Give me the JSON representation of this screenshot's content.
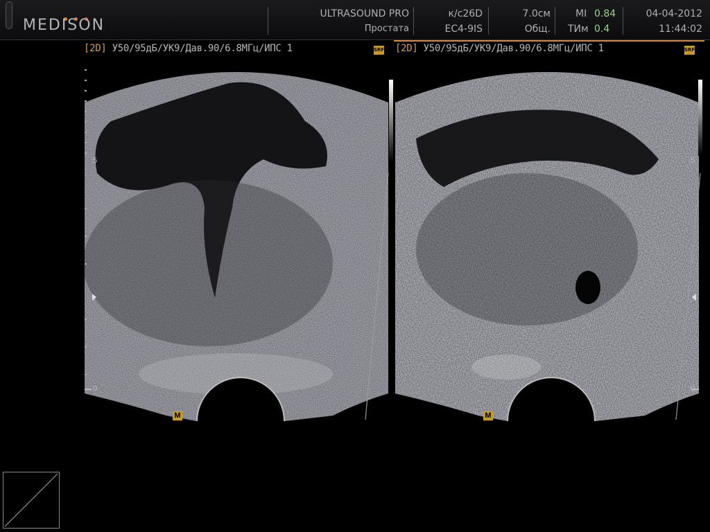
{
  "header": {
    "brand": "MEDISON",
    "system": "ULTRASOUND PRO",
    "exam": "Простата",
    "probe_label": "к/с26D",
    "probe_model": "ЕС4-9IS",
    "depth": "7.0см",
    "preset": "Общ.",
    "mi_label": "MI",
    "mi_value": "0.84",
    "tim_label": "ТИм",
    "tim_value": "0.4",
    "date": "04-04-2012",
    "time": "11:44:02"
  },
  "panels": [
    {
      "mode": "[2D]",
      "params": " У50/95дБ/УК9/Дав.90/6.8МГц/ИПС 1",
      "srf": "SRF",
      "marker": "M",
      "depth_mid": "5",
      "depth_zero": "0"
    },
    {
      "mode": "[2D]",
      "params": " У50/95дБ/УК9/Дав.90/6.8МГц/ИПС 1",
      "srf": "SRF",
      "marker": "M",
      "depth_mid": "5",
      "depth_zero": "0"
    }
  ],
  "colors": {
    "accent": "#d4883a",
    "marker": "#c69a27",
    "green_value": "#9ed08a",
    "logo_dot_1": "#e08a2a",
    "logo_dot_2": "#e07a2a",
    "logo_dot_3": "#d44a2a"
  }
}
